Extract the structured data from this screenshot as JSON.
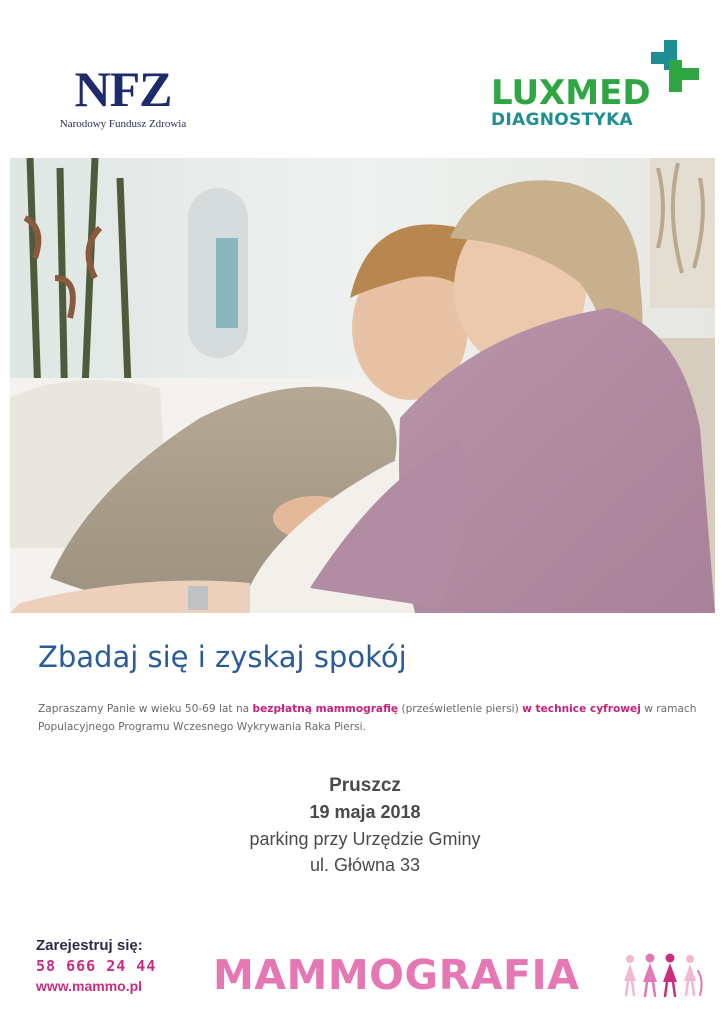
{
  "logos": {
    "nfz": {
      "mark": "NFZ",
      "subtitle": "Narodowy Fundusz Zdrowia"
    },
    "luxmed": {
      "word": "LUXMED",
      "subtitle": "DIAGNOSTYKA"
    }
  },
  "headline": "Zbadaj się i zyskaj spokój",
  "intro": {
    "part1": "Zapraszamy Panie w wieku 50-69 lat na ",
    "highlight1": "bezpłatną mammografię",
    "part2": " (prześwietlenie piersi) ",
    "highlight2": "w technice cyfrowej",
    "part3": " w ramach Populacyjnego Programu Wczesnego Wykrywania Raka Piersi."
  },
  "event": {
    "city": "Pruszcz",
    "date": "19 maja 2018",
    "place": "parking przy Urzędzie Gminy",
    "street": "ul. Główna 33"
  },
  "register": {
    "label": "Zarejestruj się:",
    "phone": "58 666 24 44",
    "url": "www.mammo.pl"
  },
  "program": {
    "name": "MAMMOGRAFIA"
  },
  "colors": {
    "nfz_navy": "#1f2a6b",
    "luxmed_green": "#2fa643",
    "luxmed_teal": "#1f8f94",
    "headline_blue": "#2a5c9a",
    "accent_pink": "#cc2c7e",
    "mammo_pink": "#e577b4"
  },
  "icons": [
    "luxmed-cross-icon",
    "women-figures-icon"
  ]
}
